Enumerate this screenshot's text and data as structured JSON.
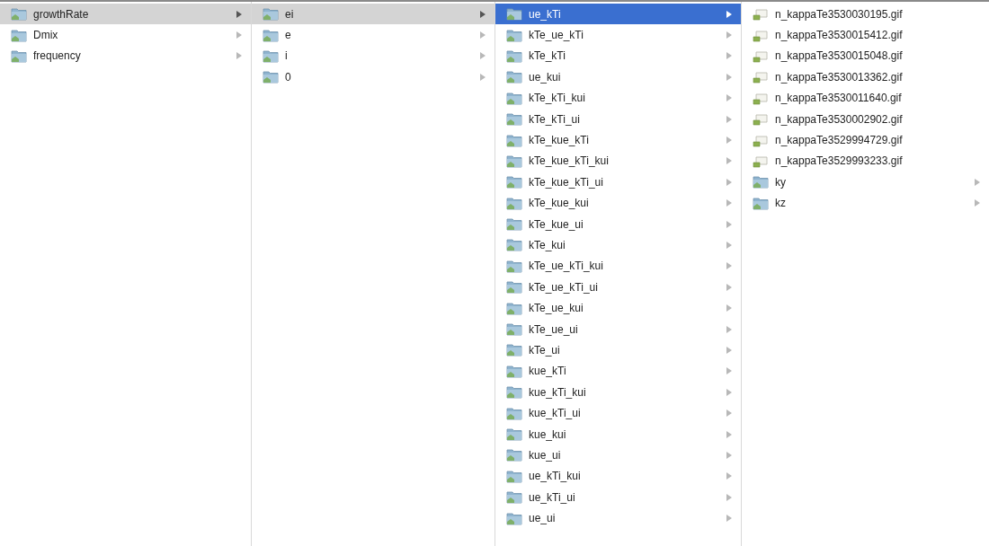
{
  "columns": [
    {
      "items": [
        {
          "name": "growthRate",
          "kind": "folder",
          "selected": true
        },
        {
          "name": "Dmix",
          "kind": "folder",
          "selected": false
        },
        {
          "name": "frequency",
          "kind": "folder",
          "selected": false
        }
      ]
    },
    {
      "items": [
        {
          "name": "ei",
          "kind": "folder",
          "selected": true
        },
        {
          "name": "e",
          "kind": "folder",
          "selected": false
        },
        {
          "name": "i",
          "kind": "folder",
          "selected": false
        },
        {
          "name": "0",
          "kind": "folder",
          "selected": false
        }
      ]
    },
    {
      "active": true,
      "items": [
        {
          "name": "ue_kTi",
          "kind": "folder",
          "selected": true
        },
        {
          "name": "kTe_ue_kTi",
          "kind": "folder",
          "selected": false
        },
        {
          "name": "kTe_kTi",
          "kind": "folder",
          "selected": false
        },
        {
          "name": "ue_kui",
          "kind": "folder",
          "selected": false
        },
        {
          "name": "kTe_kTi_kui",
          "kind": "folder",
          "selected": false
        },
        {
          "name": "kTe_kTi_ui",
          "kind": "folder",
          "selected": false
        },
        {
          "name": "kTe_kue_kTi",
          "kind": "folder",
          "selected": false
        },
        {
          "name": "kTe_kue_kTi_kui",
          "kind": "folder",
          "selected": false
        },
        {
          "name": "kTe_kue_kTi_ui",
          "kind": "folder",
          "selected": false
        },
        {
          "name": "kTe_kue_kui",
          "kind": "folder",
          "selected": false
        },
        {
          "name": "kTe_kue_ui",
          "kind": "folder",
          "selected": false
        },
        {
          "name": "kTe_kui",
          "kind": "folder",
          "selected": false
        },
        {
          "name": "kTe_ue_kTi_kui",
          "kind": "folder",
          "selected": false
        },
        {
          "name": "kTe_ue_kTi_ui",
          "kind": "folder",
          "selected": false
        },
        {
          "name": "kTe_ue_kui",
          "kind": "folder",
          "selected": false
        },
        {
          "name": "kTe_ue_ui",
          "kind": "folder",
          "selected": false
        },
        {
          "name": "kTe_ui",
          "kind": "folder",
          "selected": false
        },
        {
          "name": "kue_kTi",
          "kind": "folder",
          "selected": false
        },
        {
          "name": "kue_kTi_kui",
          "kind": "folder",
          "selected": false
        },
        {
          "name": "kue_kTi_ui",
          "kind": "folder",
          "selected": false
        },
        {
          "name": "kue_kui",
          "kind": "folder",
          "selected": false
        },
        {
          "name": "kue_ui",
          "kind": "folder",
          "selected": false
        },
        {
          "name": "ue_kTi_kui",
          "kind": "folder",
          "selected": false
        },
        {
          "name": "ue_kTi_ui",
          "kind": "folder",
          "selected": false
        },
        {
          "name": "ue_ui",
          "kind": "folder",
          "selected": false
        }
      ]
    },
    {
      "items": [
        {
          "name": "n_kappaTe3530030195.gif",
          "kind": "file",
          "selected": false
        },
        {
          "name": "n_kappaTe3530015412.gif",
          "kind": "file",
          "selected": false
        },
        {
          "name": "n_kappaTe3530015048.gif",
          "kind": "file",
          "selected": false
        },
        {
          "name": "n_kappaTe3530013362.gif",
          "kind": "file",
          "selected": false
        },
        {
          "name": "n_kappaTe3530011640.gif",
          "kind": "file",
          "selected": false
        },
        {
          "name": "n_kappaTe3530002902.gif",
          "kind": "file",
          "selected": false
        },
        {
          "name": "n_kappaTe3529994729.gif",
          "kind": "file",
          "selected": false
        },
        {
          "name": "n_kappaTe3529993233.gif",
          "kind": "file",
          "selected": false
        },
        {
          "name": "ky",
          "kind": "folder",
          "selected": false
        },
        {
          "name": "kz",
          "kind": "folder",
          "selected": false
        }
      ]
    }
  ]
}
